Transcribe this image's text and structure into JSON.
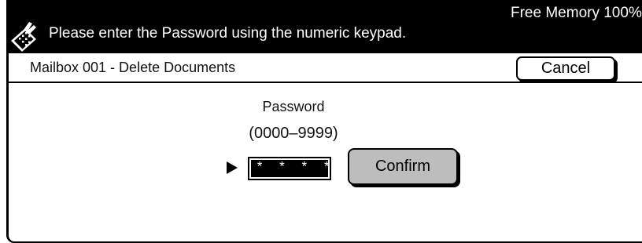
{
  "header": {
    "message": "Please enter the Password using the numeric keypad.",
    "free_memory": "Free Memory  100%",
    "icon": "keypad-hand-icon"
  },
  "titlebar": {
    "title": "Mailbox 001 - Delete Documents",
    "cancel_label": "Cancel"
  },
  "password": {
    "label": "Password",
    "range": "(0000–9999)",
    "value": "* * * *",
    "pointer_icon": "pointer-arrow-icon",
    "confirm_label": "Confirm"
  },
  "colors": {
    "header_bg": "#000000",
    "header_text": "#ffffff",
    "confirm_bg": "#bdbdbd"
  }
}
